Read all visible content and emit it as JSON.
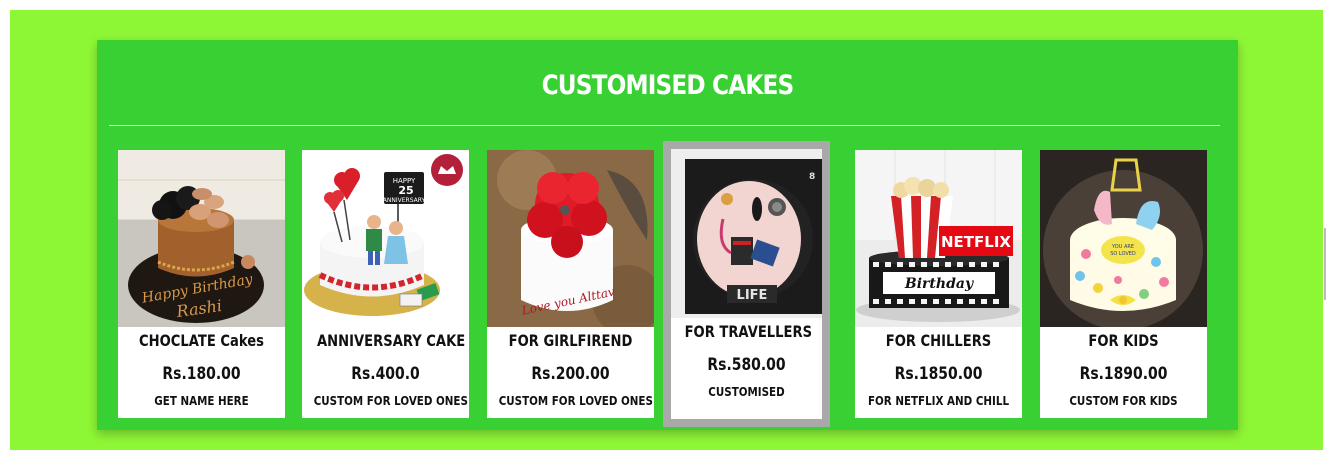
{
  "section": {
    "title": "CUSTOMISED CAKES"
  },
  "colors": {
    "page_background": "#8ef735",
    "panel_background": "#39d034",
    "card_background": "#ffffff",
    "highlight_border": "#a9a9a9"
  },
  "cards": [
    {
      "name": "CHOCLATE Cakes",
      "price": "Rs.180.00",
      "description": "GET NAME HERE",
      "image": "chocolate-birthday-cake-image",
      "cake_text": "Happy Birthday Rashi"
    },
    {
      "name": "ANNIVERSARY CAKE",
      "price": "Rs.400.0",
      "description": "CUSTOM FOR LOVED ONES",
      "image": "anniversary-cake-image",
      "cake_text": "HAPPY 25 ANNIVERSARY"
    },
    {
      "name": "FOR GIRLFIREND",
      "price": "Rs.200.00",
      "description": "CUSTOM FOR LOVED ONES",
      "image": "red-rose-cake-image",
      "cake_text": "Love you Alttav"
    },
    {
      "name": "FOR TRAVELLERS",
      "price": "Rs.580.00",
      "description": "CUSTOMISED",
      "image": "travel-theme-cake-image",
      "cake_text": "LIFE"
    },
    {
      "name": "FOR CHILLERS",
      "price": "Rs.1850.00",
      "description": "FOR NETFLIX AND CHILL",
      "image": "netflix-popcorn-cake-image",
      "cake_text": "NETFLIX",
      "cake_text_2": "Birthday"
    },
    {
      "name": "FOR KIDS",
      "price": "Rs.1890.00",
      "description": "CUSTOM FOR KIDS",
      "image": "kids-baby-shoes-cake-image"
    }
  ]
}
